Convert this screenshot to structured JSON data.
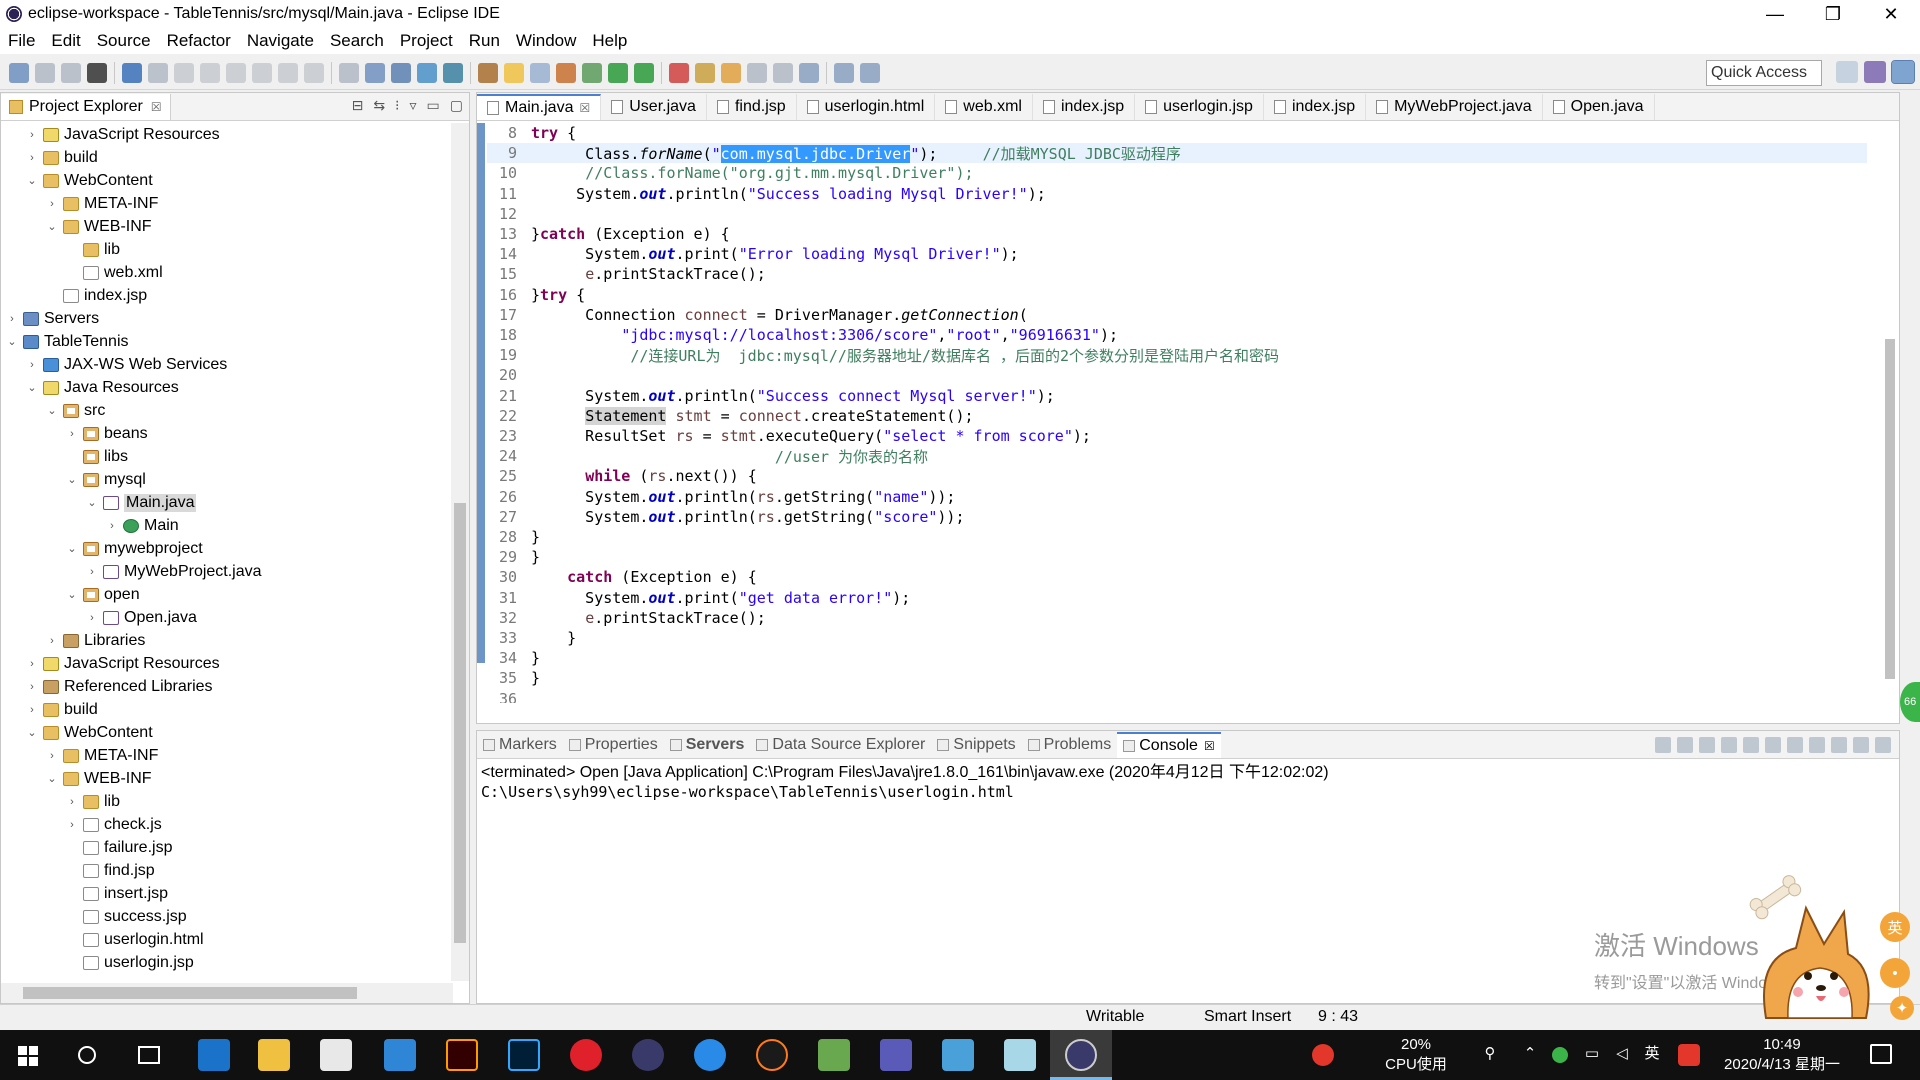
{
  "window": {
    "title": "eclipse-workspace - TableTennis/src/mysql/Main.java - Eclipse IDE",
    "minimize": "—",
    "restore": "❐",
    "close": "✕"
  },
  "menu": [
    "File",
    "Edit",
    "Source",
    "Refactor",
    "Navigate",
    "Search",
    "Project",
    "Run",
    "Window",
    "Help"
  ],
  "toolbar": {
    "quick_access": "Quick Access"
  },
  "explorer": {
    "tab_label": "Project Explorer",
    "tab_close": "☒",
    "tree": [
      {
        "label": "JavaScript Resources",
        "depth": 1,
        "arrow": "›",
        "icon": "js"
      },
      {
        "label": "build",
        "depth": 1,
        "arrow": "›",
        "icon": "folder"
      },
      {
        "label": "WebContent",
        "depth": 1,
        "arrow": "⌄",
        "icon": "folder"
      },
      {
        "label": "META-INF",
        "depth": 2,
        "arrow": "›",
        "icon": "folder"
      },
      {
        "label": "WEB-INF",
        "depth": 2,
        "arrow": "⌄",
        "icon": "folder"
      },
      {
        "label": "lib",
        "depth": 3,
        "arrow": "",
        "icon": "folder"
      },
      {
        "label": "web.xml",
        "depth": 3,
        "arrow": "",
        "icon": "file"
      },
      {
        "label": "index.jsp",
        "depth": 2,
        "arrow": "",
        "icon": "file"
      },
      {
        "label": "Servers",
        "depth": 0,
        "arrow": "›",
        "icon": "server"
      },
      {
        "label": "TableTennis",
        "depth": 0,
        "arrow": "⌄",
        "icon": "project"
      },
      {
        "label": "JAX-WS Web Services",
        "depth": 1,
        "arrow": "›",
        "icon": "ws"
      },
      {
        "label": "Java Resources",
        "depth": 1,
        "arrow": "⌄",
        "icon": "js"
      },
      {
        "label": "src",
        "depth": 2,
        "arrow": "⌄",
        "icon": "pkg"
      },
      {
        "label": "beans",
        "depth": 3,
        "arrow": "›",
        "icon": "pkg"
      },
      {
        "label": "libs",
        "depth": 3,
        "arrow": "",
        "icon": "pkg"
      },
      {
        "label": "mysql",
        "depth": 3,
        "arrow": "⌄",
        "icon": "pkg"
      },
      {
        "label": "Main.java",
        "depth": 4,
        "arrow": "⌄",
        "icon": "java",
        "selected": true
      },
      {
        "label": "Main",
        "depth": 5,
        "arrow": "›",
        "icon": "class"
      },
      {
        "label": "mywebproject",
        "depth": 3,
        "arrow": "⌄",
        "icon": "pkg"
      },
      {
        "label": "MyWebProject.java",
        "depth": 4,
        "arrow": "›",
        "icon": "java"
      },
      {
        "label": "open",
        "depth": 3,
        "arrow": "⌄",
        "icon": "pkg"
      },
      {
        "label": "Open.java",
        "depth": 4,
        "arrow": "›",
        "icon": "java"
      },
      {
        "label": "Libraries",
        "depth": 2,
        "arrow": "›",
        "icon": "lib"
      },
      {
        "label": "JavaScript Resources",
        "depth": 1,
        "arrow": "›",
        "icon": "js"
      },
      {
        "label": "Referenced Libraries",
        "depth": 1,
        "arrow": "›",
        "icon": "lib"
      },
      {
        "label": "build",
        "depth": 1,
        "arrow": "›",
        "icon": "folder"
      },
      {
        "label": "WebContent",
        "depth": 1,
        "arrow": "⌄",
        "icon": "folder"
      },
      {
        "label": "META-INF",
        "depth": 2,
        "arrow": "›",
        "icon": "folder"
      },
      {
        "label": "WEB-INF",
        "depth": 2,
        "arrow": "⌄",
        "icon": "folder"
      },
      {
        "label": "lib",
        "depth": 3,
        "arrow": "›",
        "icon": "folder"
      },
      {
        "label": "check.js",
        "depth": 3,
        "arrow": "›",
        "icon": "file"
      },
      {
        "label": "failure.jsp",
        "depth": 3,
        "arrow": "",
        "icon": "file"
      },
      {
        "label": "find.jsp",
        "depth": 3,
        "arrow": "",
        "icon": "file"
      },
      {
        "label": "insert.jsp",
        "depth": 3,
        "arrow": "",
        "icon": "file"
      },
      {
        "label": "success.jsp",
        "depth": 3,
        "arrow": "",
        "icon": "file"
      },
      {
        "label": "userlogin.html",
        "depth": 3,
        "arrow": "",
        "icon": "file"
      },
      {
        "label": "userlogin.jsp",
        "depth": 3,
        "arrow": "",
        "icon": "file"
      }
    ]
  },
  "editor": {
    "tabs": [
      {
        "label": "Main.java",
        "active": true,
        "close": "☒"
      },
      {
        "label": "User.java"
      },
      {
        "label": "find.jsp"
      },
      {
        "label": "userlogin.html"
      },
      {
        "label": "web.xml"
      },
      {
        "label": "index.jsp"
      },
      {
        "label": "userlogin.jsp"
      },
      {
        "label": "index.jsp"
      },
      {
        "label": "MyWebProject.java"
      },
      {
        "label": "Open.java"
      }
    ],
    "lines": [
      {
        "n": "8",
        "html": "<span class=\"kw\">try</span> {"
      },
      {
        "n": "9",
        "cur": true,
        "html": "      Class.<span class=\"ital\">forName</span>(<span class=\"str\">\"</span><span class=\"sel\">com.mysql.jdbc.Driver</span><span class=\"str\">\"</span>);     <span class=\"cmt\">//加载MYSQL JDBC驱动程序</span>"
      },
      {
        "n": "10",
        "html": "      <span class=\"cmt\">//Class.forName(\"org.gjt.mm.mysql.Driver\");</span>"
      },
      {
        "n": "11",
        "html": "     System.<span class=\"fld\">out</span>.println(<span class=\"str\">\"Success loading Mysql Driver!\"</span>);"
      },
      {
        "n": "12",
        "html": ""
      },
      {
        "n": "13",
        "html": "}<span class=\"kw\">catch</span> (Exception e) {"
      },
      {
        "n": "14",
        "html": "      System.<span class=\"fld\">out</span>.print(<span class=\"str\">\"Error loading Mysql Driver!\"</span>);"
      },
      {
        "n": "15",
        "html": "      <span class=\"var\">e</span>.printStackTrace();"
      },
      {
        "n": "16",
        "html": "}<span class=\"kw\">try</span> {"
      },
      {
        "n": "17",
        "html": "      Connection <span class=\"var\">connect</span> = DriverManager.<span class=\"ital\">getConnection</span>("
      },
      {
        "n": "18",
        "html": "          <span class=\"str\">\"jdbc:mysql://localhost:3306/score\"</span>,<span class=\"str\">\"root\"</span>,<span class=\"str\">\"96916631\"</span>);"
      },
      {
        "n": "19",
        "html": "           <span class=\"cmt\">//连接URL为  jdbc:mysql//服务器地址/数据库名 ，后面的2个参数分别是登陆用户名和密码</span>"
      },
      {
        "n": "20",
        "html": ""
      },
      {
        "n": "21",
        "html": "      System.<span class=\"fld\">out</span>.println(<span class=\"str\">\"Success connect Mysql server!\"</span>);"
      },
      {
        "n": "22",
        "html": "      <span class=\"hl\">Statement</span> <span class=\"var\">stmt</span> = <span class=\"var\">connect</span>.createStatement();"
      },
      {
        "n": "23",
        "html": "      ResultSet <span class=\"var\">rs</span> = <span class=\"var\">stmt</span>.executeQuery(<span class=\"str\">\"select * from score\"</span>);"
      },
      {
        "n": "24",
        "html": "                           <span class=\"cmt\">//user 为你表的名称</span>"
      },
      {
        "n": "25",
        "html": "      <span class=\"kw\">while</span> (<span class=\"var\">rs</span>.next()) {"
      },
      {
        "n": "26",
        "html": "      System.<span class=\"fld\">out</span>.println(<span class=\"var\">rs</span>.getString(<span class=\"str\">\"name\"</span>));"
      },
      {
        "n": "27",
        "html": "      System.<span class=\"fld\">out</span>.println(<span class=\"var\">rs</span>.getString(<span class=\"str\">\"score\"</span>));"
      },
      {
        "n": "28",
        "html": "}"
      },
      {
        "n": "29",
        "html": "}"
      },
      {
        "n": "30",
        "html": "    <span class=\"kw\">catch</span> (Exception e) {"
      },
      {
        "n": "31",
        "html": "      System.<span class=\"fld\">out</span>.print(<span class=\"str\">\"get data error!\"</span>);"
      },
      {
        "n": "32",
        "html": "      <span class=\"var\">e</span>.printStackTrace();"
      },
      {
        "n": "33",
        "html": "    }"
      },
      {
        "n": "34",
        "html": "}"
      },
      {
        "n": "35",
        "html": "}"
      },
      {
        "n": "36",
        "html": ""
      }
    ]
  },
  "console": {
    "tabs": [
      {
        "label": "Markers"
      },
      {
        "label": "Properties"
      },
      {
        "label": "Servers",
        "bold": true
      },
      {
        "label": "Data Source Explorer"
      },
      {
        "label": "Snippets"
      },
      {
        "label": "Problems"
      },
      {
        "label": "Console",
        "active": true,
        "close": "☒"
      }
    ],
    "terminated": "<terminated> Open [Java Application] C:\\Program Files\\Java\\jre1.8.0_161\\bin\\javaw.exe (2020年4月12日 下午12:02:02)",
    "output": "C:\\Users\\syh99\\eclipse-workspace\\TableTennis\\userlogin.html"
  },
  "status": {
    "writable": "Writable",
    "insert_mode": "Smart Insert",
    "position": "9 : 43"
  },
  "watermark": {
    "line1": "激活 Windows",
    "line2": "转到\"设置\"以激活 Windows。"
  },
  "ime_badge": "英",
  "taskbar": {
    "cpu_percent": "20%",
    "cpu_label": "CPU使用",
    "lang": "英",
    "time": "10:49",
    "date": "2020/4/13 星期一",
    "edge_badge": "66"
  }
}
